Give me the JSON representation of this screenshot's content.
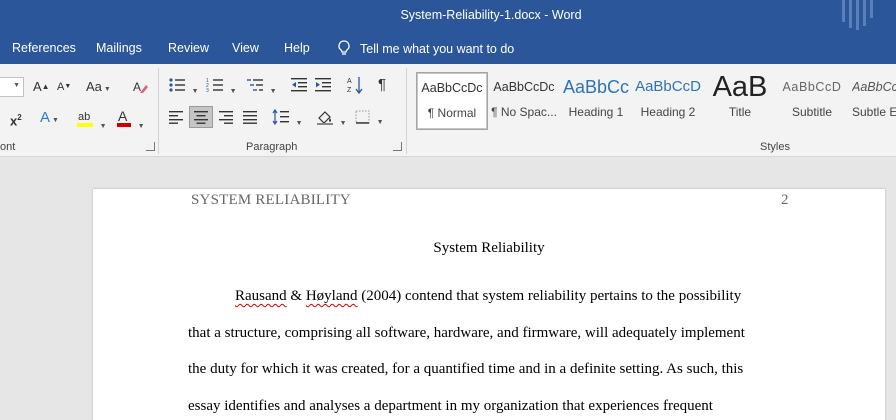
{
  "window": {
    "title": "System-Reliability-1.docx  -  Word"
  },
  "tabs": [
    "References",
    "Mailings",
    "Review",
    "View",
    "Help"
  ],
  "tell_me": {
    "text": "Tell me what you want to do"
  },
  "ribbon": {
    "font_group_label": "ont",
    "paragraph_group_label": "Paragraph",
    "styles_group_label": "Styles",
    "styles": [
      {
        "preview": "AaBbCcDc",
        "name": "¶ Normal"
      },
      {
        "preview": "AaBbCcDc",
        "name": "¶ No Spac..."
      },
      {
        "preview": "AaBbCc",
        "name": "Heading 1"
      },
      {
        "preview": "AaBbCcD",
        "name": "Heading 2"
      },
      {
        "preview": "AaB",
        "name": "Title"
      },
      {
        "preview": "AaBbCcD",
        "name": "Subtitle"
      },
      {
        "preview": "AaBbCcD",
        "name": "Subtle E"
      }
    ],
    "colors": {
      "highlight": "#ffff00",
      "font_color": "#d00000",
      "accent": "#2b579a"
    }
  },
  "document": {
    "header_left": "SYSTEM RELIABILITY",
    "page_number": "2",
    "title": "System Reliability",
    "line1": {
      "author1": "Rausand",
      "amp": " & ",
      "author2": "Høyland",
      "rest": " (2004) contend that system reliability pertains to the possibility"
    },
    "line2": "that a structure, comprising all software, hardware, and firmware, will adequately implement",
    "line3": "the duty for which it was created, for a quantified time and in a definite setting. As such, this",
    "line4": "essay identifies and analyses a department in my organization that experiences frequent"
  }
}
